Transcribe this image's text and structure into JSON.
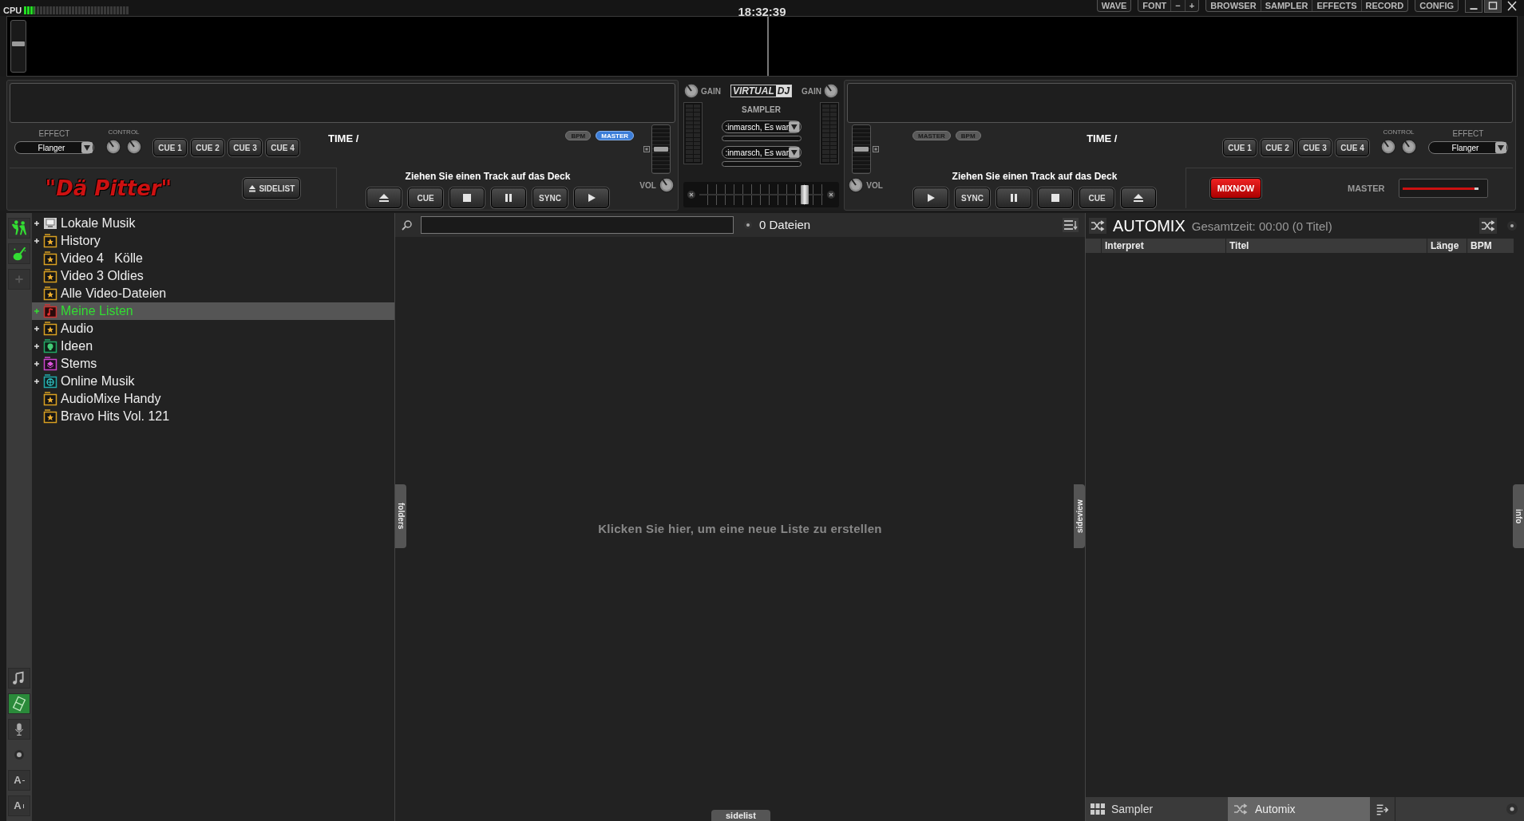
{
  "top_bar": {
    "cpu_label": "CPU",
    "cpu_meter": {
      "level": 0.1
    },
    "clock": "18:32:39",
    "button_groups": [
      [
        "WAVE"
      ],
      [
        "FONT",
        "−",
        "+"
      ],
      [
        "BROWSER",
        "SAMPLER",
        "EFFECTS",
        "RECORD"
      ],
      [
        "CONFIG"
      ]
    ]
  },
  "waveform": {
    "zoom_slider": {
      "level": 0.55
    }
  },
  "decks": [
    {
      "effect_label": "EFFECT",
      "effect": "Flanger",
      "control_label": "CONTROL",
      "cues": [
        "CUE 1",
        "CUE 2",
        "CUE 3",
        "CUE 4"
      ],
      "time": "TIME /",
      "badges": [
        {
          "label": "BPM",
          "selected": false
        },
        {
          "label": "MASTER",
          "selected": true
        }
      ],
      "hint": "Ziehen Sie einen Track auf das Deck",
      "transport": [
        {
          "kind": "eject"
        },
        {
          "kind": "text",
          "label": "CUE"
        },
        {
          "kind": "stop"
        },
        {
          "kind": "pause"
        },
        {
          "kind": "text",
          "label": "SYNC"
        },
        {
          "kind": "play"
        }
      ],
      "pitch": {
        "level": 0.5
      },
      "vol_label": "VOL",
      "logo": "\"Dä Pitter\"",
      "sidelist_button": "SIDELIST"
    },
    {
      "effect_label": "EFFECT",
      "effect": "Flanger",
      "control_label": "CONTROL",
      "cues": [
        "CUE 1",
        "CUE 2",
        "CUE 3",
        "CUE 4"
      ],
      "time": "TIME /",
      "badges": [
        {
          "label": "MASTER",
          "selected": false
        },
        {
          "label": "BPM",
          "selected": false
        }
      ],
      "hint": "Ziehen Sie einen Track auf das Deck",
      "transport": [
        {
          "kind": "play"
        },
        {
          "kind": "text",
          "label": "SYNC"
        },
        {
          "kind": "pause"
        },
        {
          "kind": "stop"
        },
        {
          "kind": "text",
          "label": "CUE"
        },
        {
          "kind": "eject"
        }
      ],
      "pitch": {
        "level": 0.5
      },
      "vol_label": "VOL",
      "mixnow_button": "MIXNOW",
      "master_label": "MASTER",
      "master_slider": {
        "level": 0.95
      }
    }
  ],
  "mixer": {
    "gain_labels": [
      "GAIN",
      "GAIN"
    ],
    "logo": {
      "left": "VIRTUAL",
      "right": "DJ"
    },
    "sampler_label": "SAMPLER",
    "sampler_slots": [
      ":inmarsch, Es war",
      ":inmarsch, Es war"
    ],
    "crossfader": {
      "level": 0.85
    }
  },
  "browser": {
    "side_icons": [
      {
        "kind": "note",
        "selected": false
      },
      {
        "kind": "film",
        "selected": true
      },
      {
        "kind": "mic",
        "selected": false
      },
      {
        "kind": "dot",
        "selected": false
      },
      {
        "kind": "font_smaller",
        "label": "A",
        "selected": false
      },
      {
        "kind": "font_larger",
        "label": "A",
        "selected": false
      }
    ],
    "tree": [
      {
        "label": "Lokale Musik",
        "kind": "computer",
        "has_children": true,
        "selected": false
      },
      {
        "label": "History",
        "kind": "star",
        "has_children": true,
        "selected": false
      },
      {
        "label": "Video 4   Kölle",
        "kind": "star",
        "has_children": false,
        "selected": false
      },
      {
        "label": "Video 3 Oldies",
        "kind": "star",
        "has_children": false,
        "selected": false
      },
      {
        "label": "Alle Video-Dateien",
        "kind": "star",
        "has_children": false,
        "selected": false
      },
      {
        "label": "Meine Listen",
        "kind": "playlist",
        "has_children": true,
        "selected": true
      },
      {
        "label": "Audio",
        "kind": "star",
        "has_children": true,
        "selected": false
      },
      {
        "label": "Ideen",
        "kind": "idea",
        "has_children": true,
        "selected": false
      },
      {
        "label": "Stems",
        "kind": "stems",
        "has_children": true,
        "selected": false
      },
      {
        "label": "Online Musik",
        "kind": "online",
        "has_children": true,
        "selected": false
      },
      {
        "label": "AudioMixe Handy",
        "kind": "star",
        "has_children": false,
        "selected": false
      },
      {
        "label": "Bravo Hits Vol. 121",
        "kind": "star",
        "has_children": false,
        "selected": false
      }
    ],
    "file_list": {
      "count": "0 Dateien",
      "empty_message": "Klicken Sie hier, um eine neue Liste zu erstellen"
    },
    "folders_tab": "folders",
    "sideview_tab": "sideview",
    "sidelist_tab": "sidelist",
    "info_tab": "info"
  },
  "automix": {
    "title": "AUTOMIX",
    "summary": "Gesamtzeit: 00:00 (0 Titel)",
    "columns": [
      "Interpret",
      "Titel",
      "Länge",
      "BPM"
    ],
    "tabs": [
      {
        "label": "Sampler",
        "kind": "sampler",
        "selected": false
      },
      {
        "label": "Automix",
        "kind": "automix",
        "selected": true
      }
    ]
  }
}
